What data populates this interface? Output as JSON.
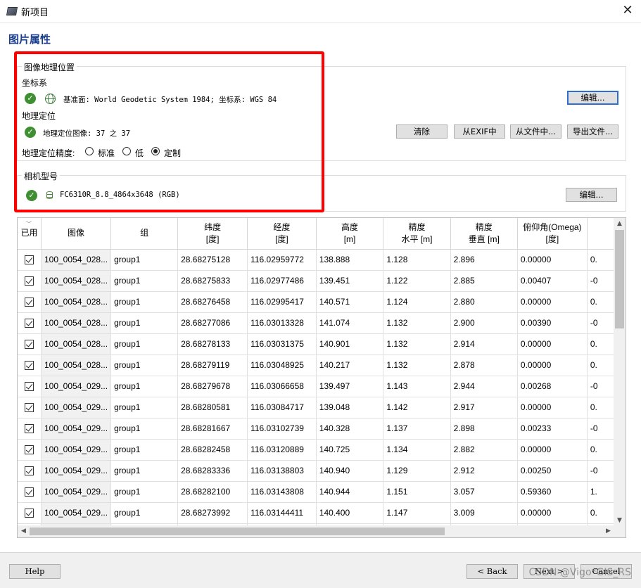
{
  "window": {
    "title": "新项目",
    "close_glyph": "✕"
  },
  "page_title": "图片属性",
  "geo": {
    "group_title": "图像地理位置",
    "crs_label": "坐标系",
    "crs_text": "基准面: World Geodetic System 1984; 坐标系: WGS 84",
    "edit_label": "编辑...",
    "georef_label": "地理定位",
    "georef_text": "地理定位图像: 37 之 37",
    "clear_label": "清除",
    "from_exif_label": "从EXIF中",
    "from_file_label": "从文件中...",
    "export_label": "导出文件...",
    "accuracy_label": "地理定位精度:",
    "accuracy_options": [
      "标准",
      "低",
      "定制"
    ],
    "accuracy_selected": "定制"
  },
  "camera": {
    "group_title": "相机型号",
    "model_text": "FC6310R_8.8_4864x3648 (RGB)",
    "edit_label": "编辑..."
  },
  "table": {
    "sort_glyph": "﹀",
    "headers": [
      {
        "line1": "已用",
        "line2": ""
      },
      {
        "line1": "图像",
        "line2": ""
      },
      {
        "line1": "组",
        "line2": ""
      },
      {
        "line1": "纬度",
        "line2": "[度]"
      },
      {
        "line1": "经度",
        "line2": "[度]"
      },
      {
        "line1": "高度",
        "line2": "[m]"
      },
      {
        "line1": "精度",
        "line2": "水平 [m]"
      },
      {
        "line1": "精度",
        "line2": "垂直 [m]"
      },
      {
        "line1": "俯仰角(Omega)",
        "line2": "[度]"
      },
      {
        "line1": "",
        "line2": ""
      }
    ],
    "rows": [
      {
        "image": "100_0054_028...",
        "group": "group1",
        "lat": "28.68275128",
        "lon": "116.02959772",
        "alt": "138.888",
        "acc_h": "1.128",
        "acc_v": "2.896",
        "omega": "0.00000",
        "next": "0."
      },
      {
        "image": "100_0054_028...",
        "group": "group1",
        "lat": "28.68275833",
        "lon": "116.02977486",
        "alt": "139.451",
        "acc_h": "1.122",
        "acc_v": "2.885",
        "omega": "0.00407",
        "next": "-0"
      },
      {
        "image": "100_0054_028...",
        "group": "group1",
        "lat": "28.68276458",
        "lon": "116.02995417",
        "alt": "140.571",
        "acc_h": "1.124",
        "acc_v": "2.880",
        "omega": "0.00000",
        "next": "0."
      },
      {
        "image": "100_0054_028...",
        "group": "group1",
        "lat": "28.68277086",
        "lon": "116.03013328",
        "alt": "141.074",
        "acc_h": "1.132",
        "acc_v": "2.900",
        "omega": "0.00390",
        "next": "-0"
      },
      {
        "image": "100_0054_028...",
        "group": "group1",
        "lat": "28.68278133",
        "lon": "116.03031375",
        "alt": "140.901",
        "acc_h": "1.132",
        "acc_v": "2.914",
        "omega": "0.00000",
        "next": "0."
      },
      {
        "image": "100_0054_028...",
        "group": "group1",
        "lat": "28.68279119",
        "lon": "116.03048925",
        "alt": "140.217",
        "acc_h": "1.132",
        "acc_v": "2.878",
        "omega": "0.00000",
        "next": "0."
      },
      {
        "image": "100_0054_029...",
        "group": "group1",
        "lat": "28.68279678",
        "lon": "116.03066658",
        "alt": "139.497",
        "acc_h": "1.143",
        "acc_v": "2.944",
        "omega": "0.00268",
        "next": "-0"
      },
      {
        "image": "100_0054_029...",
        "group": "group1",
        "lat": "28.68280581",
        "lon": "116.03084717",
        "alt": "139.048",
        "acc_h": "1.142",
        "acc_v": "2.917",
        "omega": "0.00000",
        "next": "0."
      },
      {
        "image": "100_0054_029...",
        "group": "group1",
        "lat": "28.68281667",
        "lon": "116.03102739",
        "alt": "140.328",
        "acc_h": "1.137",
        "acc_v": "2.898",
        "omega": "0.00233",
        "next": "-0"
      },
      {
        "image": "100_0054_029...",
        "group": "group1",
        "lat": "28.68282458",
        "lon": "116.03120889",
        "alt": "140.725",
        "acc_h": "1.134",
        "acc_v": "2.882",
        "omega": "0.00000",
        "next": "0."
      },
      {
        "image": "100_0054_029...",
        "group": "group1",
        "lat": "28.68283336",
        "lon": "116.03138803",
        "alt": "140.940",
        "acc_h": "1.129",
        "acc_v": "2.912",
        "omega": "0.00250",
        "next": "-0"
      },
      {
        "image": "100_0054_029...",
        "group": "group1",
        "lat": "28.68282100",
        "lon": "116.03143808",
        "alt": "140.944",
        "acc_h": "1.151",
        "acc_v": "3.057",
        "omega": "0.59360",
        "next": "1."
      },
      {
        "image": "100_0054_029...",
        "group": "group1",
        "lat": "28.68273992",
        "lon": "116.03144411",
        "alt": "140.400",
        "acc_h": "1.147",
        "acc_v": "3.009",
        "omega": "0.00000",
        "next": "0."
      },
      {
        "image": "",
        "group": "",
        "lat": "",
        "lon": "",
        "alt": "",
        "acc_h": "",
        "acc_v": "",
        "omega": "",
        "next": ""
      }
    ]
  },
  "footer": {
    "help_label": "Help",
    "back_label": "< Back",
    "next_label": "Next >",
    "cancel_label": "Cancel"
  },
  "watermark": "CSDN @Vigo*GIS_RS",
  "colors": {
    "title_blue": "#1a3e8c",
    "highlight_red": "#ff0000",
    "check_green": "#3f8f32"
  }
}
